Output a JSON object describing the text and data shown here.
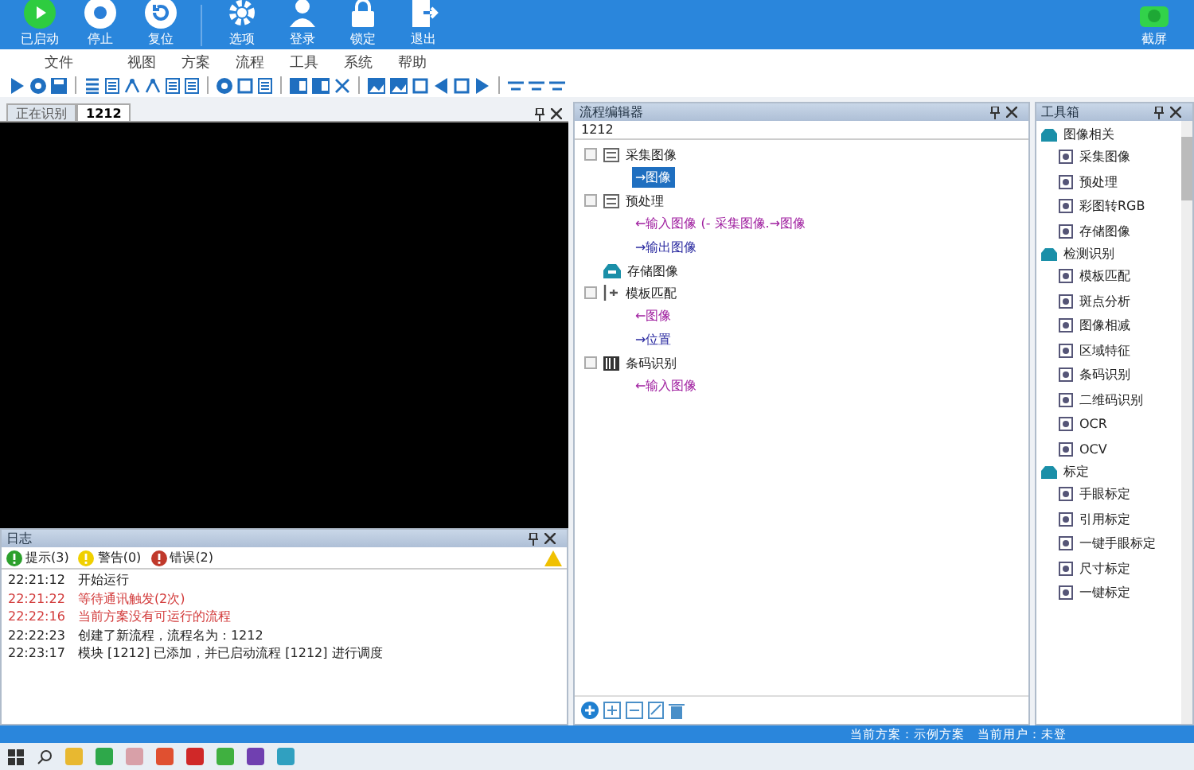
{
  "header": {
    "buttons": [
      {
        "label": "已启动",
        "kind": "run"
      },
      {
        "label": "停止",
        "kind": "stop"
      },
      {
        "label": "复位",
        "kind": "reset"
      },
      {
        "label": "选项",
        "kind": "gear"
      },
      {
        "label": "登录",
        "kind": "user"
      },
      {
        "label": "锁定",
        "kind": "lock"
      },
      {
        "label": "退出",
        "kind": "exit"
      }
    ],
    "right_button": {
      "label": "截屏"
    }
  },
  "menu": [
    "文件",
    "视图",
    "方案",
    "流程",
    "工具",
    "系统",
    "帮助"
  ],
  "image_panel": {
    "tabs": [
      {
        "label": "正在识别",
        "selected": false
      },
      {
        "label": "1212",
        "selected": true
      }
    ]
  },
  "log": {
    "title": "日志",
    "filters": [
      {
        "label": "提示(3)",
        "kind": "info"
      },
      {
        "label": "警告(0)",
        "kind": "warning"
      },
      {
        "label": "错误(2)",
        "kind": "error"
      }
    ],
    "entries": [
      {
        "time": "22:21:12",
        "text": "开始运行",
        "error": false
      },
      {
        "time": "22:21:22",
        "text": "等待通讯触发(2次)",
        "error": true
      },
      {
        "time": "22:22:16",
        "text": "当前方案没有可运行的流程",
        "error": true
      },
      {
        "time": "22:22:23",
        "text": "创建了新流程，流程名为：1212",
        "error": false
      },
      {
        "time": "22:23:17",
        "text": "模块 [1212] 已添加，并已启动流程 [1212] 进行调度",
        "error": false
      }
    ]
  },
  "flow_editor": {
    "title": "流程编辑器",
    "flow_name": "1212",
    "nodes": [
      {
        "label": "采集图像",
        "kind": "capture",
        "expanded": true,
        "children": [
          {
            "label": "→图像",
            "kind": "output",
            "selected": true
          }
        ]
      },
      {
        "label": "预处理",
        "kind": "capture",
        "expanded": true,
        "children": [
          {
            "label": "←输入图像 (- 采集图像.→图像",
            "kind": "input",
            "selected": false
          },
          {
            "label": "→输出图像",
            "kind": "output",
            "selected": false
          }
        ]
      },
      {
        "label": "存储图像",
        "kind": "store",
        "expanded": false
      },
      {
        "label": "模板匹配",
        "kind": "match",
        "expanded": true,
        "children": [
          {
            "label": "←图像",
            "kind": "input",
            "selected": false
          },
          {
            "label": "→位置",
            "kind": "output",
            "selected": false
          }
        ]
      },
      {
        "label": "条码识别",
        "kind": "barcode",
        "expanded": true,
        "children": [
          {
            "label": "←输入图像",
            "kind": "input",
            "selected": false
          }
        ]
      }
    ]
  },
  "toolbox": {
    "title": "工具箱",
    "groups": [
      {
        "label": "图像相关",
        "items": [
          "采集图像",
          "预处理",
          "彩图转RGB",
          "存储图像"
        ]
      },
      {
        "label": "检测识别",
        "items": [
          "模板匹配",
          "斑点分析",
          "图像相减",
          "区域特征",
          "条码识别",
          "二维码识别",
          "OCR",
          "OCV"
        ]
      },
      {
        "label": "标定",
        "items": [
          "手眼标定",
          "引用标定",
          "一键手眼标定",
          "尺寸标定",
          "一键标定"
        ]
      }
    ]
  },
  "status_bar": [
    "当前方案：示例方案",
    "当前用户：未登"
  ]
}
